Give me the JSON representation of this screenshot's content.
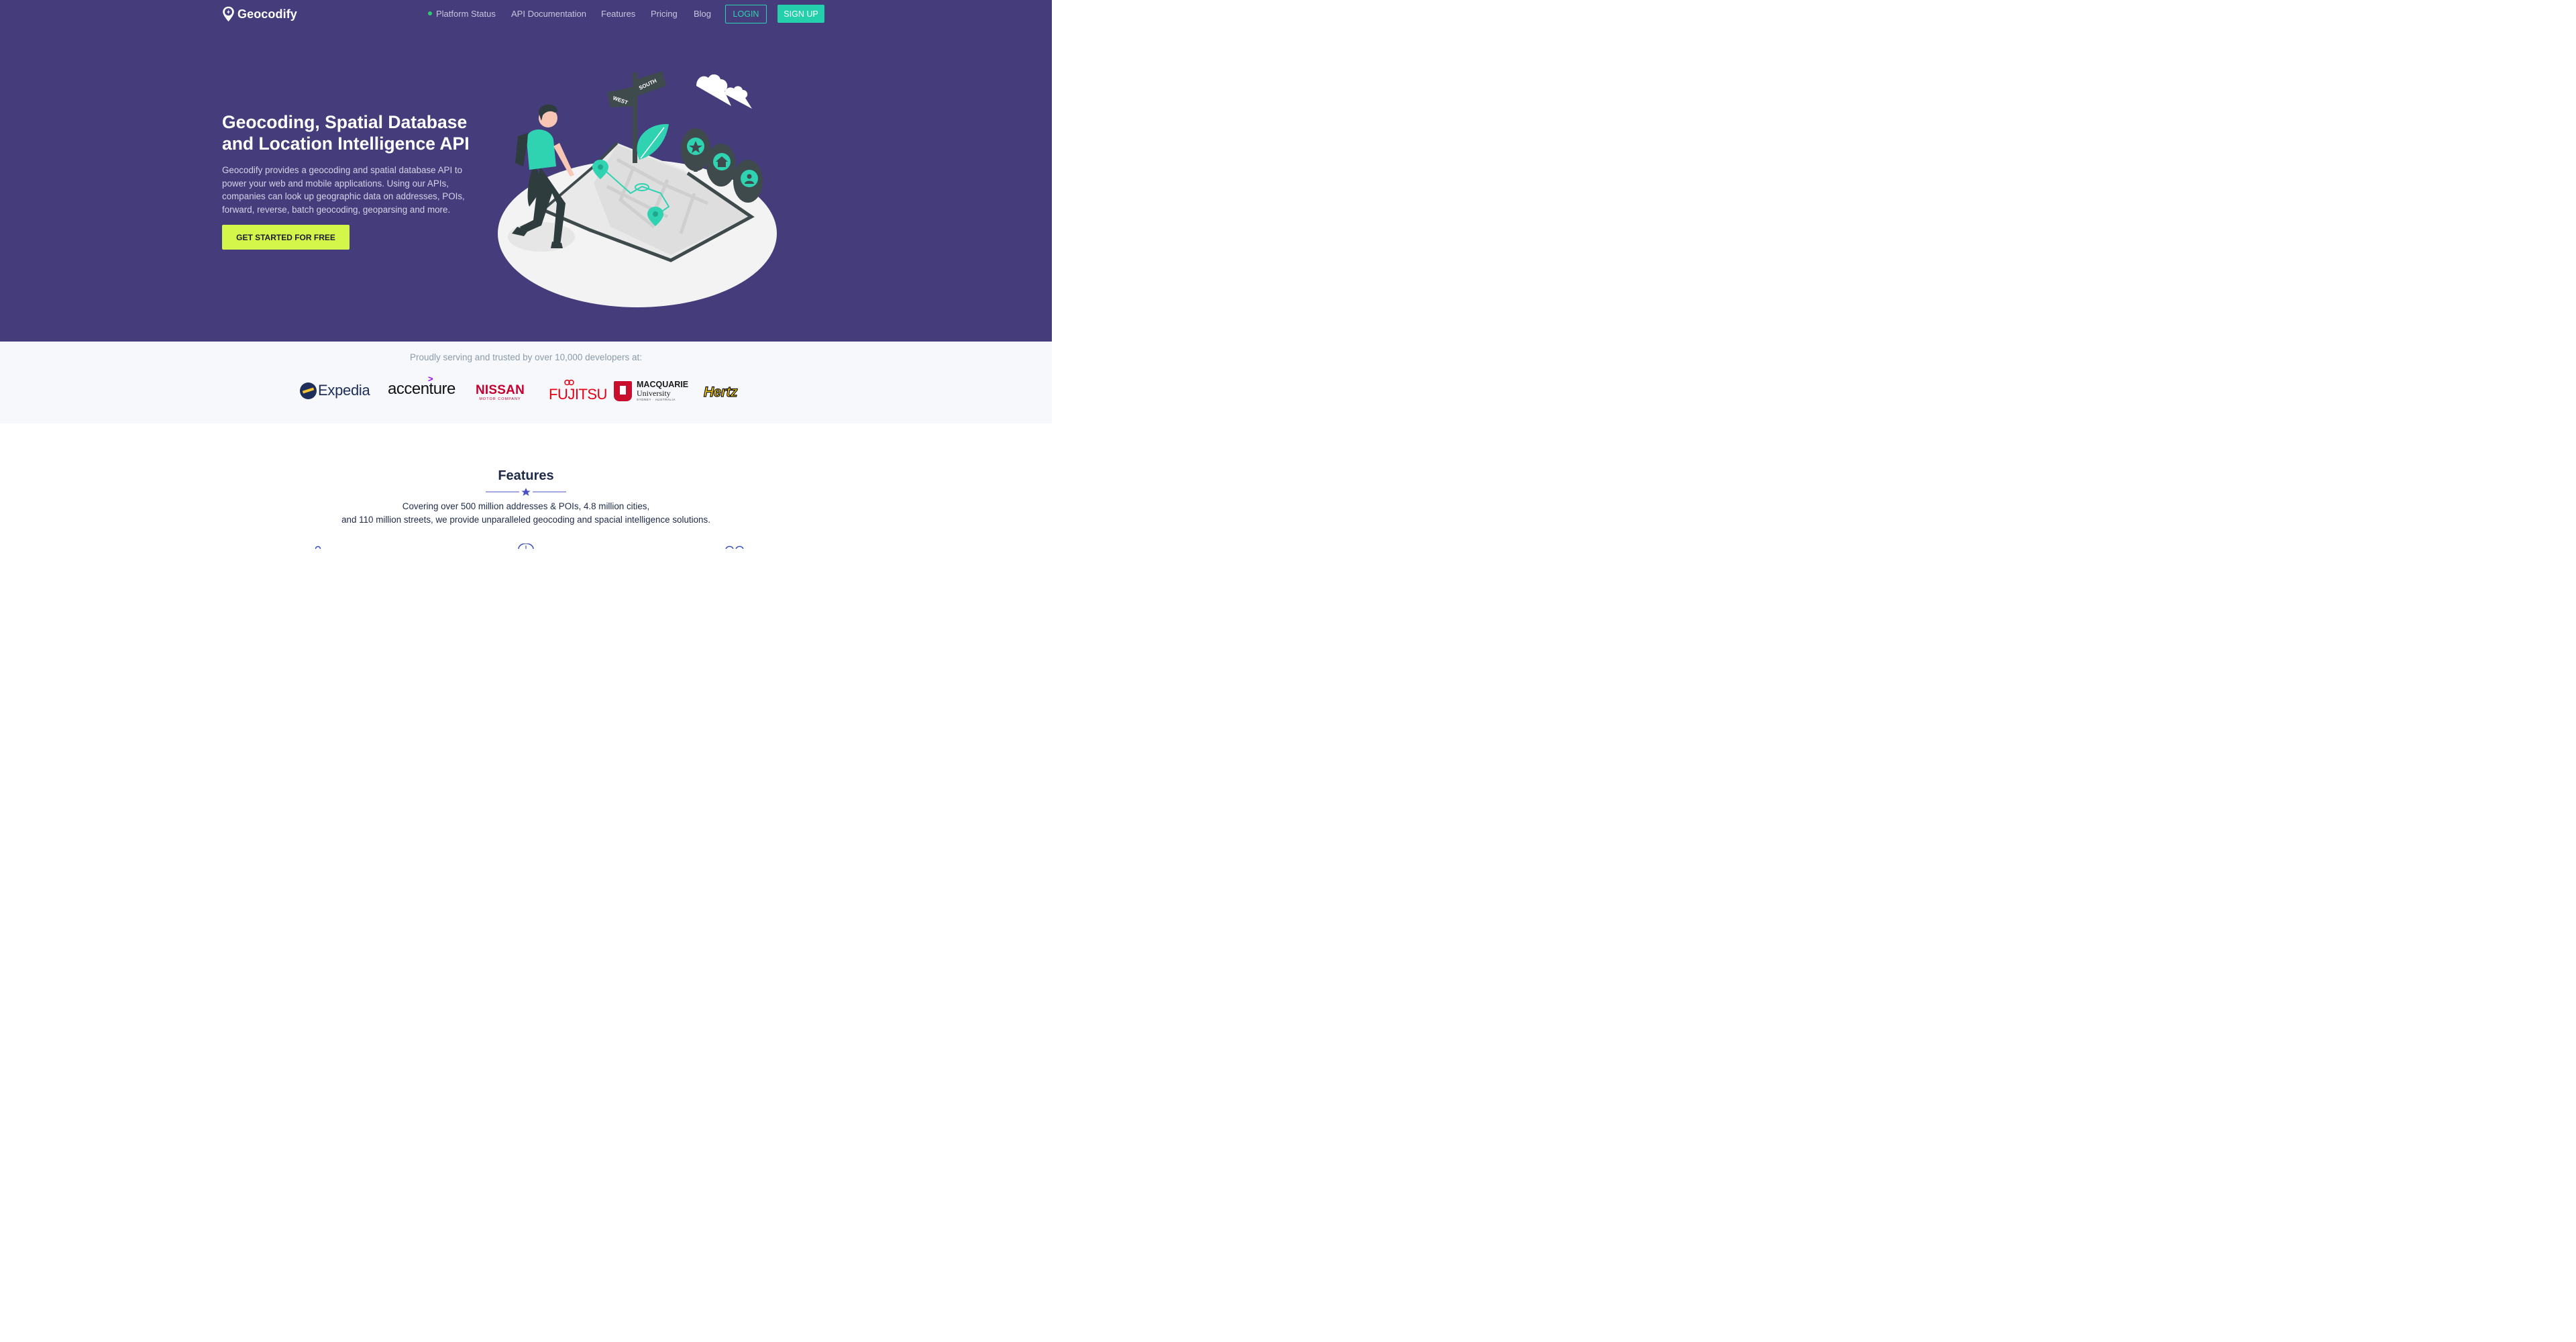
{
  "nav": {
    "brand": "Geocodify",
    "items": [
      {
        "label": "Platform Status"
      },
      {
        "label": "API Documentation"
      },
      {
        "label": "Features"
      },
      {
        "label": "Pricing"
      },
      {
        "label": "Blog"
      }
    ],
    "login_label": "LOGIN",
    "signup_label": "SIGN UP"
  },
  "hero": {
    "title": "Geocoding, Spatial Database and Location Intelligence API",
    "description": "Geocodify provides a geocoding and spatial database API to power your web and mobile applications. Using our APIs, companies can look up geographic data on addresses, POIs, forward, reverse, batch geocoding, geoparsing and more.",
    "cta_label": "GET STARTED FOR FREE",
    "signpost": {
      "west": "WEST",
      "south": "SOUTH"
    }
  },
  "trusted": {
    "text": "Proudly serving and trusted by over 10,000 developers at:",
    "logos": {
      "expedia": "Expedia",
      "accenture": "accenture",
      "nissan": "NISSAN",
      "nissan_sub": "MOTOR COMPANY",
      "fujitsu": "FUJITSU",
      "macquarie_1": "MACQUARIE",
      "macquarie_2": "University",
      "macquarie_3": "SYDNEY · AUSTRALIA",
      "hertz": "Hertz"
    }
  },
  "features": {
    "title": "Features",
    "line1": "Covering over 500 million addresses & POIs, 4.8 million cities,",
    "line2": "and 110 million streets, we provide unparalleled geocoding and spacial intelligence solutions."
  },
  "colors": {
    "hero_bg": "#453c7b",
    "accent_teal": "#24d0ab",
    "cta_lime": "#d4f54a",
    "status_dot": "#2ecc71"
  }
}
